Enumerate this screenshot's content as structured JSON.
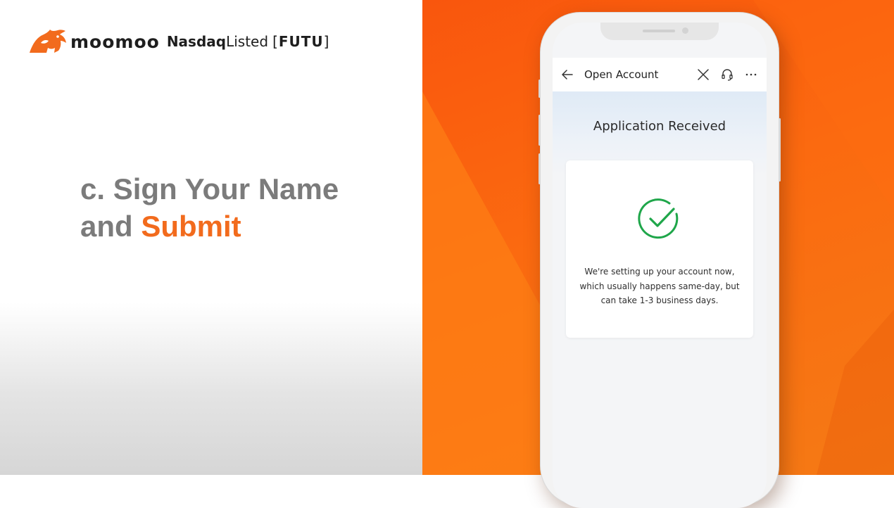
{
  "brand": {
    "name": "moomoo",
    "exchange": "Nasdaq",
    "listed": "Listed",
    "ticker_open": "[",
    "ticker": "FUTU",
    "ticker_close": "]",
    "logo_icon": "bull-icon",
    "color_orange": "#f26b1d"
  },
  "slide": {
    "line1": "c. Sign Your Name",
    "line2_prefix": "and ",
    "line2_accent": "Submit"
  },
  "phone": {
    "nav": {
      "title": "Open Account",
      "back_icon": "arrow-left-icon",
      "close_icon": "close-icon",
      "support_icon": "headset-icon",
      "more_icon": "more-horizontal-icon"
    },
    "heading": "Application Received",
    "status_icon": "check-circle-icon",
    "status_color": "#1fa64a",
    "message_lines": [
      "We're setting up your account now,",
      "which usually happens same-day, but",
      "can take 1-3 business days."
    ]
  }
}
